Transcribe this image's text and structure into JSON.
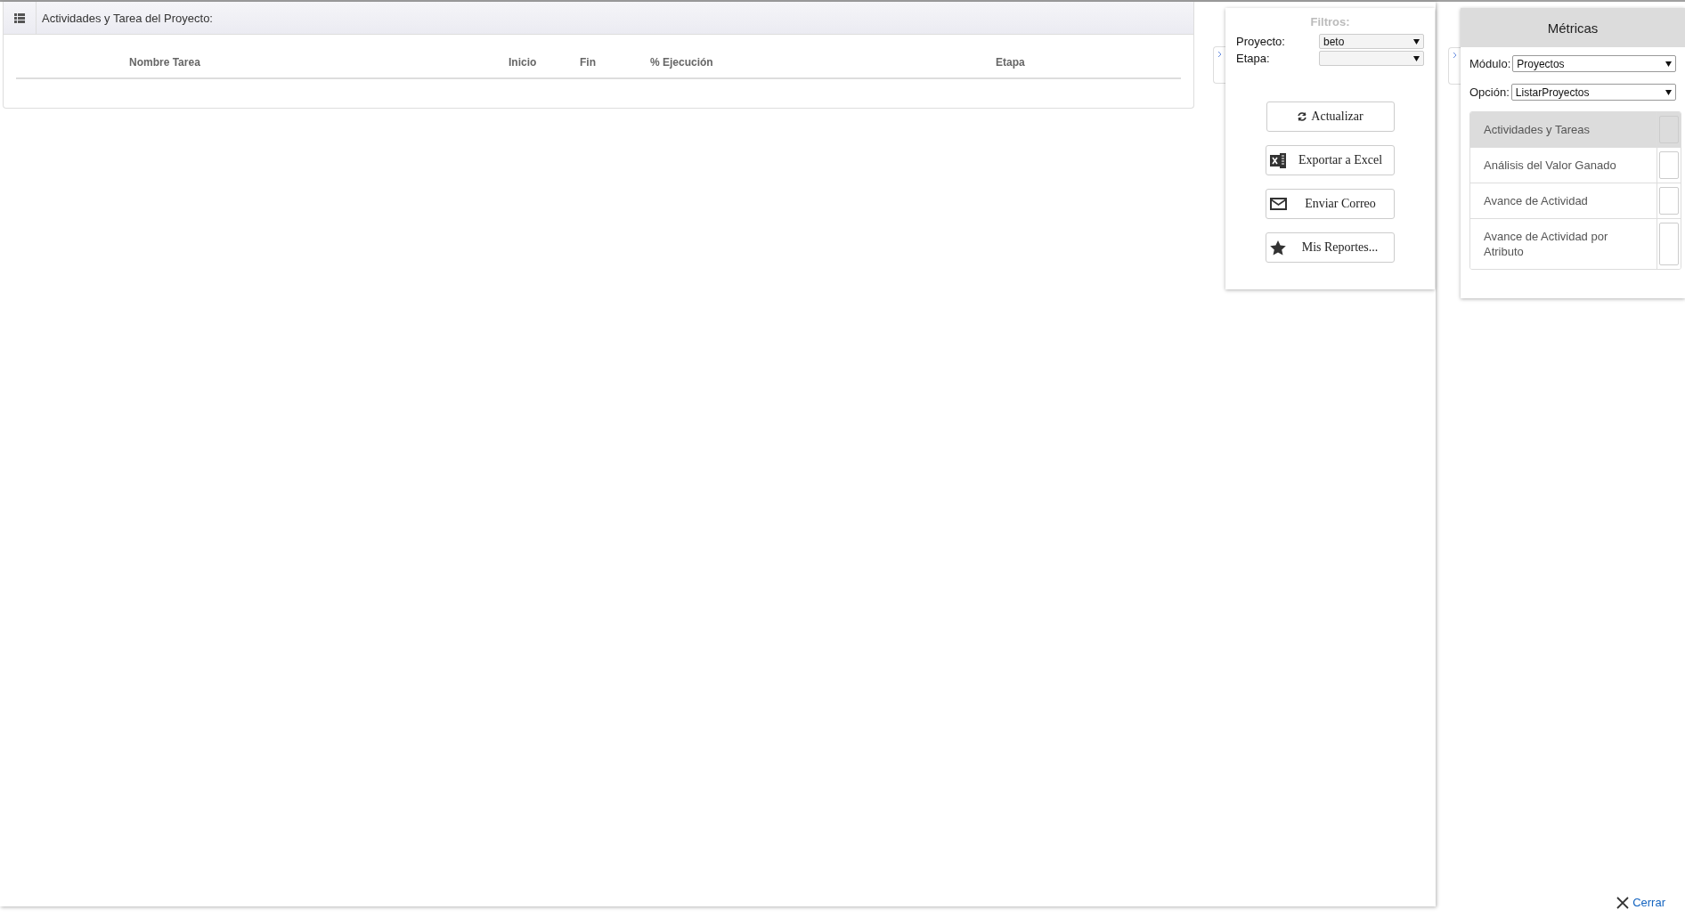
{
  "table_panel": {
    "title": "Actividades y Tarea del Proyecto:",
    "columns": [
      "Nombre Tarea",
      "Inicio",
      "Fin",
      "% Ejecución",
      "Etapa"
    ]
  },
  "filters": {
    "title": "Filtros:",
    "fields": [
      {
        "label": "Proyecto:",
        "value": "beto"
      },
      {
        "label": "Etapa:"
      }
    ],
    "buttons": [
      {
        "kind": "refresh",
        "label": "Actualizar"
      },
      {
        "kind": "excel",
        "label": "Exportar a Excel"
      },
      {
        "kind": "mail",
        "label": "Enviar Correo"
      },
      {
        "kind": "star",
        "label": "Mis Reportes..."
      }
    ]
  },
  "metrics": {
    "title": "Métricas",
    "fields": [
      {
        "label": "Módulo:",
        "value": "Proyectos"
      },
      {
        "label": "Opción:",
        "value": "ListarProyectos"
      }
    ],
    "items": [
      {
        "label": "Actividades y Tareas",
        "selected": true
      },
      {
        "label": "Análisis del Valor Ganado",
        "selected": false
      },
      {
        "label": "Avance de Actividad",
        "selected": false
      },
      {
        "label": "Avance de Actividad por Atributo",
        "selected": false
      }
    ]
  },
  "close": {
    "label": "Cerrar"
  }
}
